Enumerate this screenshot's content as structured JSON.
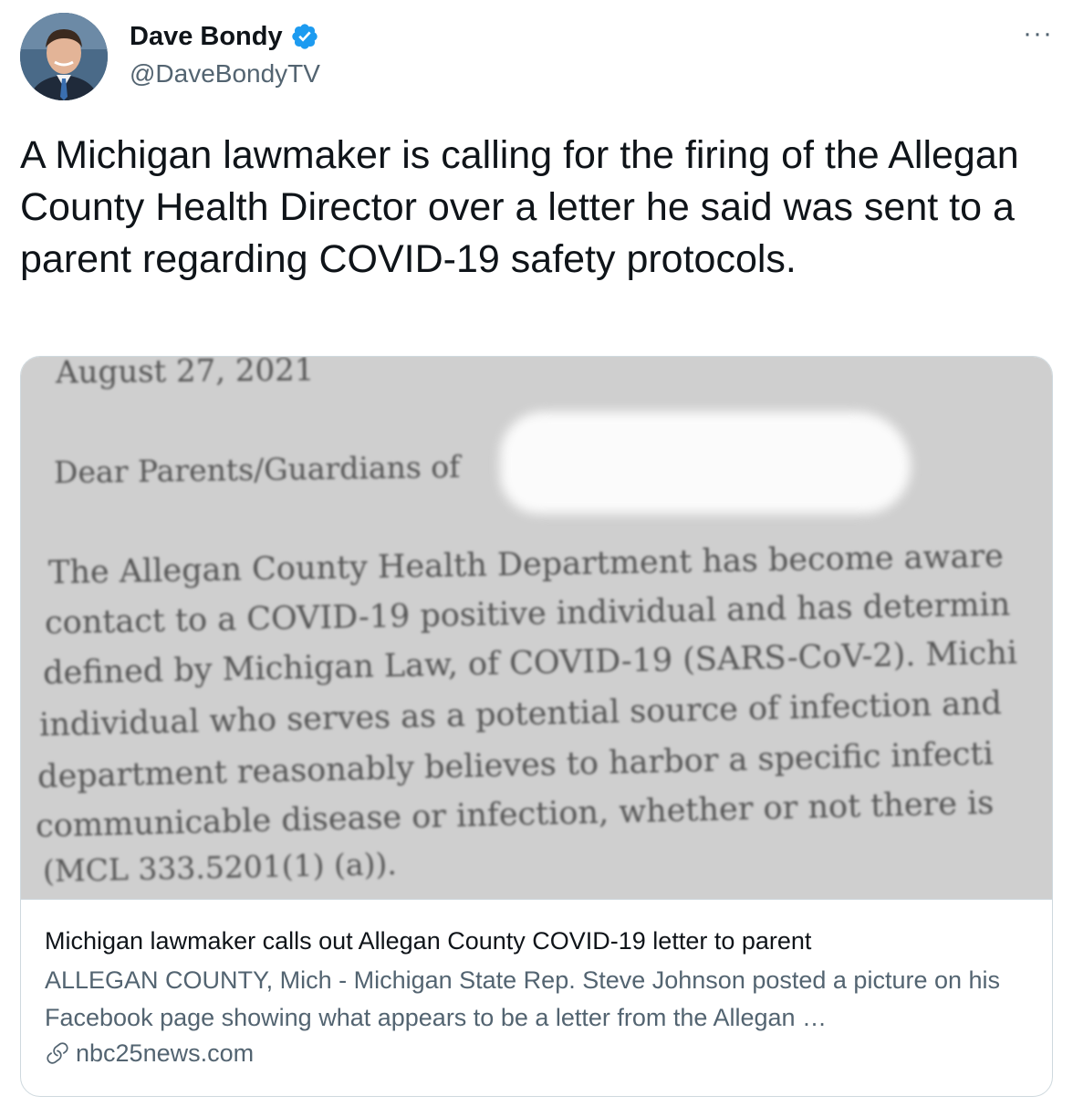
{
  "user": {
    "name": "Dave Bondy",
    "handle": "@DaveBondyTV"
  },
  "more_label": "···",
  "tweet": {
    "text": "A Michigan lawmaker is calling for the firing of the Allegan County Health Director over a letter he said was sent to a parent regarding COVID-19 safety protocols."
  },
  "card": {
    "letter_lines": [
      "August 27, 2021",
      "Dear Parents/Guardians of",
      "The Allegan County Health Department has become aware",
      "contact to a COVID-19 positive individual and has determin",
      "defined by Michigan Law, of COVID-19 (SARS-CoV-2). Michi",
      "individual who serves as a potential source of infection and",
      "department reasonably believes to harbor a specific infecti",
      "communicable disease or infection, whether or not there is",
      "(MCL 333.5201(1) (a))."
    ],
    "title": "Michigan lawmaker calls out Allegan County COVID-19 letter to parent",
    "description": "ALLEGAN COUNTY, Mich - Michigan State Rep. Steve Johnson posted a picture on his Facebook page showing what appears to be a letter from the Allegan …",
    "domain": "nbc25news.com"
  },
  "colors": {
    "verified": "#1d9bf0",
    "secondary_text": "#536471",
    "border": "#cfd9de"
  },
  "icons": [
    "verified-badge-icon",
    "more-icon",
    "link-icon"
  ]
}
